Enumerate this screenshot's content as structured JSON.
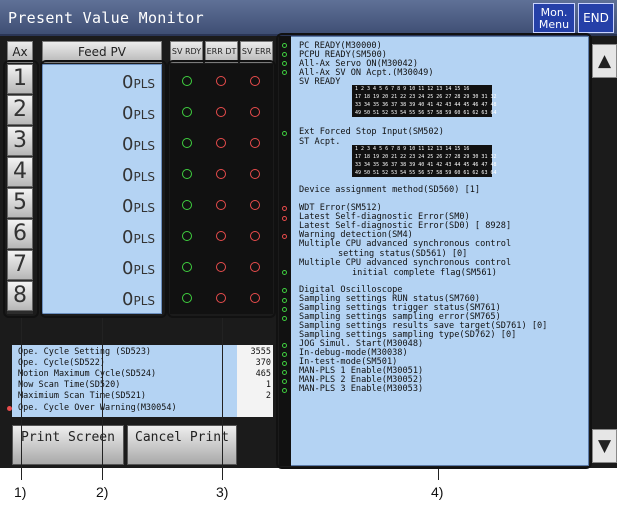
{
  "window": {
    "title": "Present Value Monitor",
    "mon_menu": "Mon. Menu",
    "end": "END"
  },
  "headers": {
    "ax": "Ax",
    "feed": "Feed PV",
    "sv_rdy": "SV RDY",
    "err_dt": "ERR DT",
    "sv_err": "SV ERR"
  },
  "axes": [
    "1",
    "2",
    "3",
    "4",
    "5",
    "6",
    "7",
    "8"
  ],
  "feed_values": [
    "0",
    "0",
    "0",
    "0",
    "0",
    "0",
    "0",
    "0"
  ],
  "unit": "PLS",
  "left_info": {
    "lines": [
      "Ope. Cycle Setting (SD523)",
      "Ope. Cycle(SD522)",
      "Motion Maximum Cycle(SD524)",
      "Now Scan Time(SD520)",
      "Maximium Scan Time(SD521)",
      "Ope. Cycle Over Warning(M30054)"
    ],
    "values": [
      "3555",
      "370",
      "465",
      "1",
      "2"
    ]
  },
  "buttons": {
    "print": "Print Screen",
    "cancel": "Cancel Print"
  },
  "right_lines": [
    "PC READY(M30000)",
    "PCPU READY(SM500)",
    "All-Ax Servo ON(M30042)",
    "All-Ax SV ON Acpt.(M30049)",
    "SV READY",
    "Ext Forced Stop Input(SM502)",
    "ST Acpt.",
    "Device assignment method(SD560) [1]",
    "WDT Error(SM512)",
    "Latest Self-diagnostic Error(SM0)",
    "Latest Self-diagnostic Error(SD0) [ 8928]",
    "Warning detection(SM4)",
    "Multiple CPU advanced synchronous control",
    "setting status(SD561) [0]",
    "Multiple CPU advanced synchronous control",
    "initial complete flag(SM561)",
    "Digital Oscilloscope",
    "Sampling settings RUN status(SM760)",
    "Sampling settings trigger status(SM761)",
    "Sampling settings sampling error(SM765)",
    "Sampling settings results save target(SD761) [0]",
    "Sampling settings sampling type(SD762) [0]",
    "JOG Simul. Start(M30048)",
    "In-debug-mode(M30038)",
    "In-test-mode(SM501)",
    "MAN-PLS 1 Enable(M30051)",
    "MAN-PLS 2 Enable(M30052)",
    "MAN-PLS 3 Enable(M30053)"
  ],
  "grid_rows": [
    "1 2 3 4 5 6 7 8 9 10 11 12 13 14 15 16",
    "17 18 19 20 21 22 23 24 25 26 27 28 29 30 31 32",
    "33 34 35 36 37 38 39 40 41 42 43 44 45 46 47 48",
    "49 50 51 52 53 54 55 56 57 58 59 60 61 62 63 64"
  ],
  "callouts": [
    "1)",
    "2)",
    "3)",
    "4)"
  ],
  "colors": {
    "panel": "#b4d3f3",
    "title": "#4b5c84",
    "led_on": "#3fcf3f",
    "led_off": "#e84c4c"
  }
}
